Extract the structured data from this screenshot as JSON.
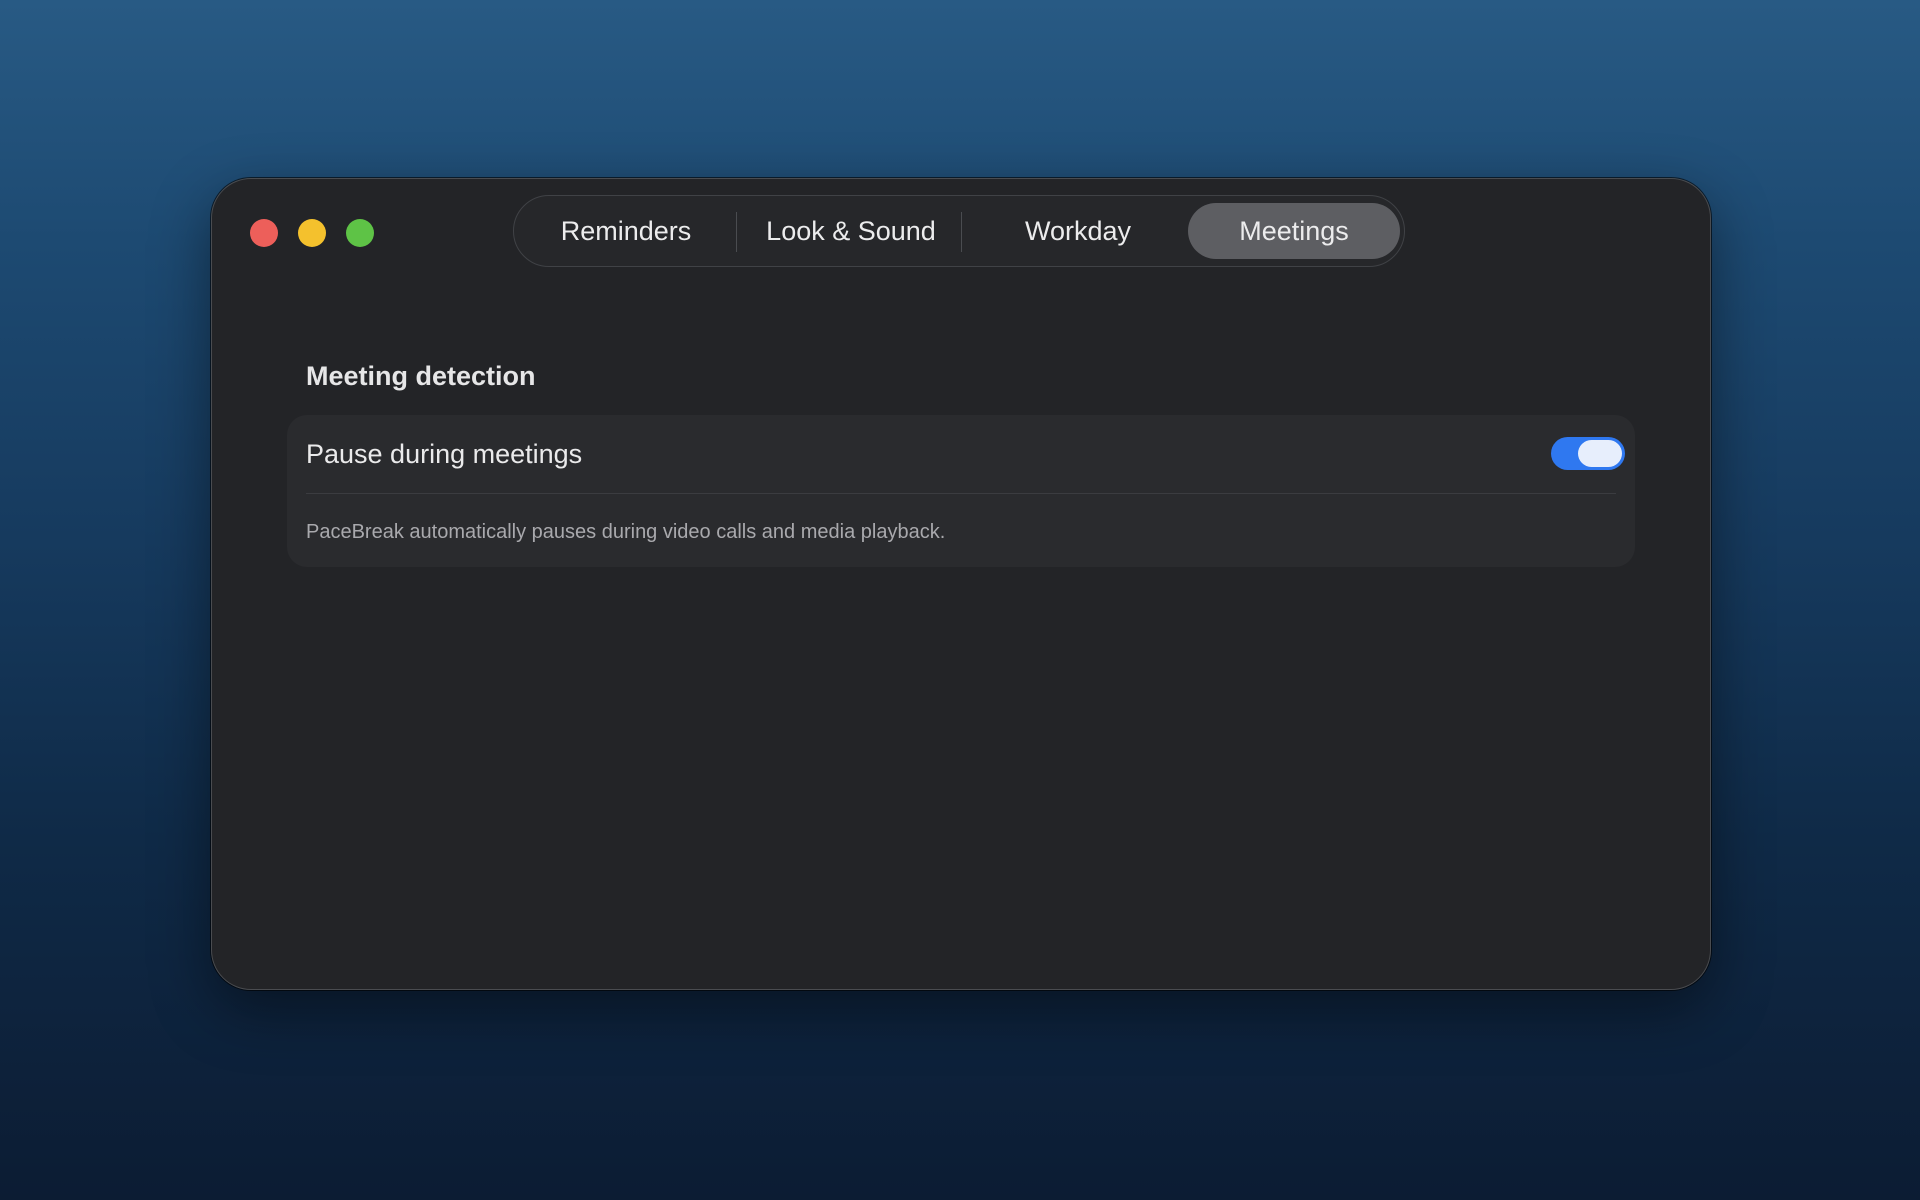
{
  "window": {
    "traffic_lights": {
      "close": "#ed5f5a",
      "minimize": "#f4c12d",
      "maximize": "#5ec346"
    }
  },
  "tabs": [
    {
      "label": "Reminders",
      "active": false
    },
    {
      "label": "Look & Sound",
      "active": false
    },
    {
      "label": "Workday",
      "active": false
    },
    {
      "label": "Meetings",
      "active": true
    }
  ],
  "meetings": {
    "section_title": "Meeting detection",
    "pause_label": "Pause during meetings",
    "pause_enabled": true,
    "caption": "PaceBreak automatically pauses during video calls and media playback."
  },
  "colors": {
    "toggle_on": "#2f78f0",
    "window_bg": "#232427",
    "card_bg": "#2a2b2e"
  }
}
